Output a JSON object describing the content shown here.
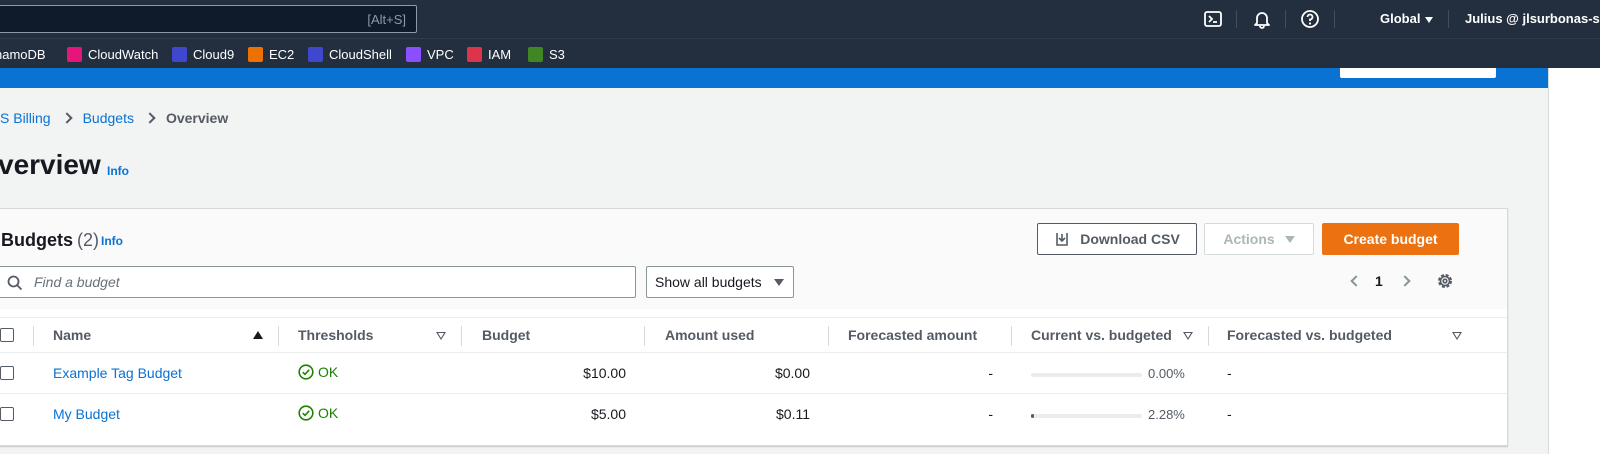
{
  "topnav": {
    "search_hint": "[Alt+S]",
    "region": "Global",
    "user": "Julius @ jlsurbonas-sap"
  },
  "favorites": [
    {
      "label": "namoDB",
      "color": ""
    },
    {
      "label": "CloudWatch",
      "color": "#e7157b"
    },
    {
      "label": "Cloud9",
      "color": "#3f48cc"
    },
    {
      "label": "EC2",
      "color": "#ed7100"
    },
    {
      "label": "CloudShell",
      "color": "#3f48cc"
    },
    {
      "label": "VPC",
      "color": "#8c4fff"
    },
    {
      "label": "IAM",
      "color": "#dd344c"
    },
    {
      "label": "S3",
      "color": "#3f8624"
    }
  ],
  "breadcrumb": {
    "items": [
      "S Billing",
      "Budgets"
    ],
    "current": "Overview"
  },
  "page": {
    "title": "verview",
    "info": "Info"
  },
  "panel": {
    "title": "Budgets",
    "count": "(2)",
    "info": "Info",
    "download_label": "Download CSV",
    "actions_label": "Actions",
    "create_label": "Create budget",
    "search_placeholder": "Find a budget",
    "filter_value": "Show all budgets",
    "page_number": "1"
  },
  "table": {
    "columns": [
      "Name",
      "Thresholds",
      "Budget",
      "Amount used",
      "Forecasted amount",
      "Current vs. budgeted",
      "Forecasted vs. budgeted"
    ],
    "rows": [
      {
        "name": "Example Tag Budget",
        "threshold": "OK",
        "budget": "$10.00",
        "used": "$0.00",
        "forecast": "-",
        "current_pct": "0.00%",
        "current_fraction": 0.0,
        "forecast_vs": "-"
      },
      {
        "name": "My Budget",
        "threshold": "OK",
        "budget": "$5.00",
        "used": "$0.11",
        "forecast": "-",
        "current_pct": "2.28%",
        "current_fraction": 0.0228,
        "forecast_vs": "-"
      }
    ]
  },
  "colors": {
    "nav_bg": "#232f3e",
    "banner": "#0972d3",
    "primary_button": "#ec7211",
    "link": "#0972d3",
    "success": "#1d8102"
  }
}
